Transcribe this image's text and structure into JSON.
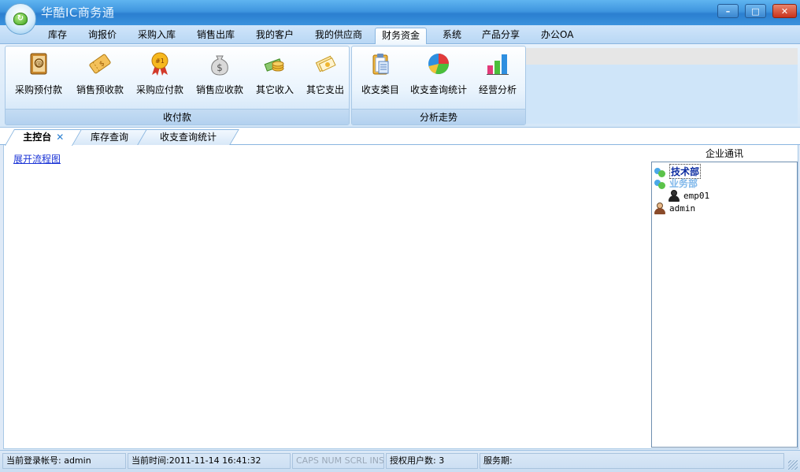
{
  "window": {
    "title": "华酷IC商务通",
    "buttons": {
      "minimize": "–",
      "maximize": "□",
      "close": "✕"
    }
  },
  "menu": {
    "items": [
      "库存",
      "询报价",
      "采购入库",
      "销售出库",
      "我的客户",
      "我的供应商",
      "财务资金",
      "系统",
      "产品分享",
      "办公OA"
    ],
    "active": "财务资金"
  },
  "ribbon": {
    "groups": [
      {
        "caption": "收付款",
        "buttons": [
          {
            "label": "采购预付款",
            "icon": "address-book-icon"
          },
          {
            "label": "销售预收款",
            "icon": "ticket-icon"
          },
          {
            "label": "采购应付款",
            "icon": "award-ribbon-icon",
            "icon_text": "#1"
          },
          {
            "label": "销售应收款",
            "icon": "money-bag-icon",
            "icon_text": "$"
          },
          {
            "label": "其它收入",
            "icon": "coins-icon"
          },
          {
            "label": "其它支出",
            "icon": "cash-out-icon"
          }
        ]
      },
      {
        "caption": "分析走势",
        "buttons": [
          {
            "label": "收支类目",
            "icon": "clipboard-icon"
          },
          {
            "label": "收支查询统计",
            "icon": "pie-chart-icon"
          },
          {
            "label": "经营分析",
            "icon": "bar-chart-icon"
          }
        ]
      }
    ]
  },
  "doc_tabs": [
    {
      "label": "主控台",
      "active": true,
      "close": "✕"
    },
    {
      "label": "库存查询",
      "active": false
    },
    {
      "label": "收支查询统计",
      "active": false
    }
  ],
  "main": {
    "flow_link": "展开流程图"
  },
  "contacts": {
    "title": "企业通讯",
    "tree": [
      {
        "label": "技术部",
        "type": "department",
        "selected": true
      },
      {
        "label": "业务部",
        "type": "department"
      },
      {
        "label": "emp01",
        "type": "user",
        "indent": 1
      },
      {
        "label": "admin",
        "type": "user",
        "indent": 0
      }
    ]
  },
  "statusbar": {
    "account": "当前登录帐号: admin",
    "time": "当前时间:2011-11-14 16:41:32",
    "keys": "CAPS  NUM  SCRL  INS",
    "licensed": "授权用户数: 3",
    "service": "服务期:"
  },
  "colors": {
    "title_bar": "#3f96df",
    "ribbon": "#d5e7f8",
    "link": "#1a33d6",
    "accent": "#2b7fd0"
  }
}
